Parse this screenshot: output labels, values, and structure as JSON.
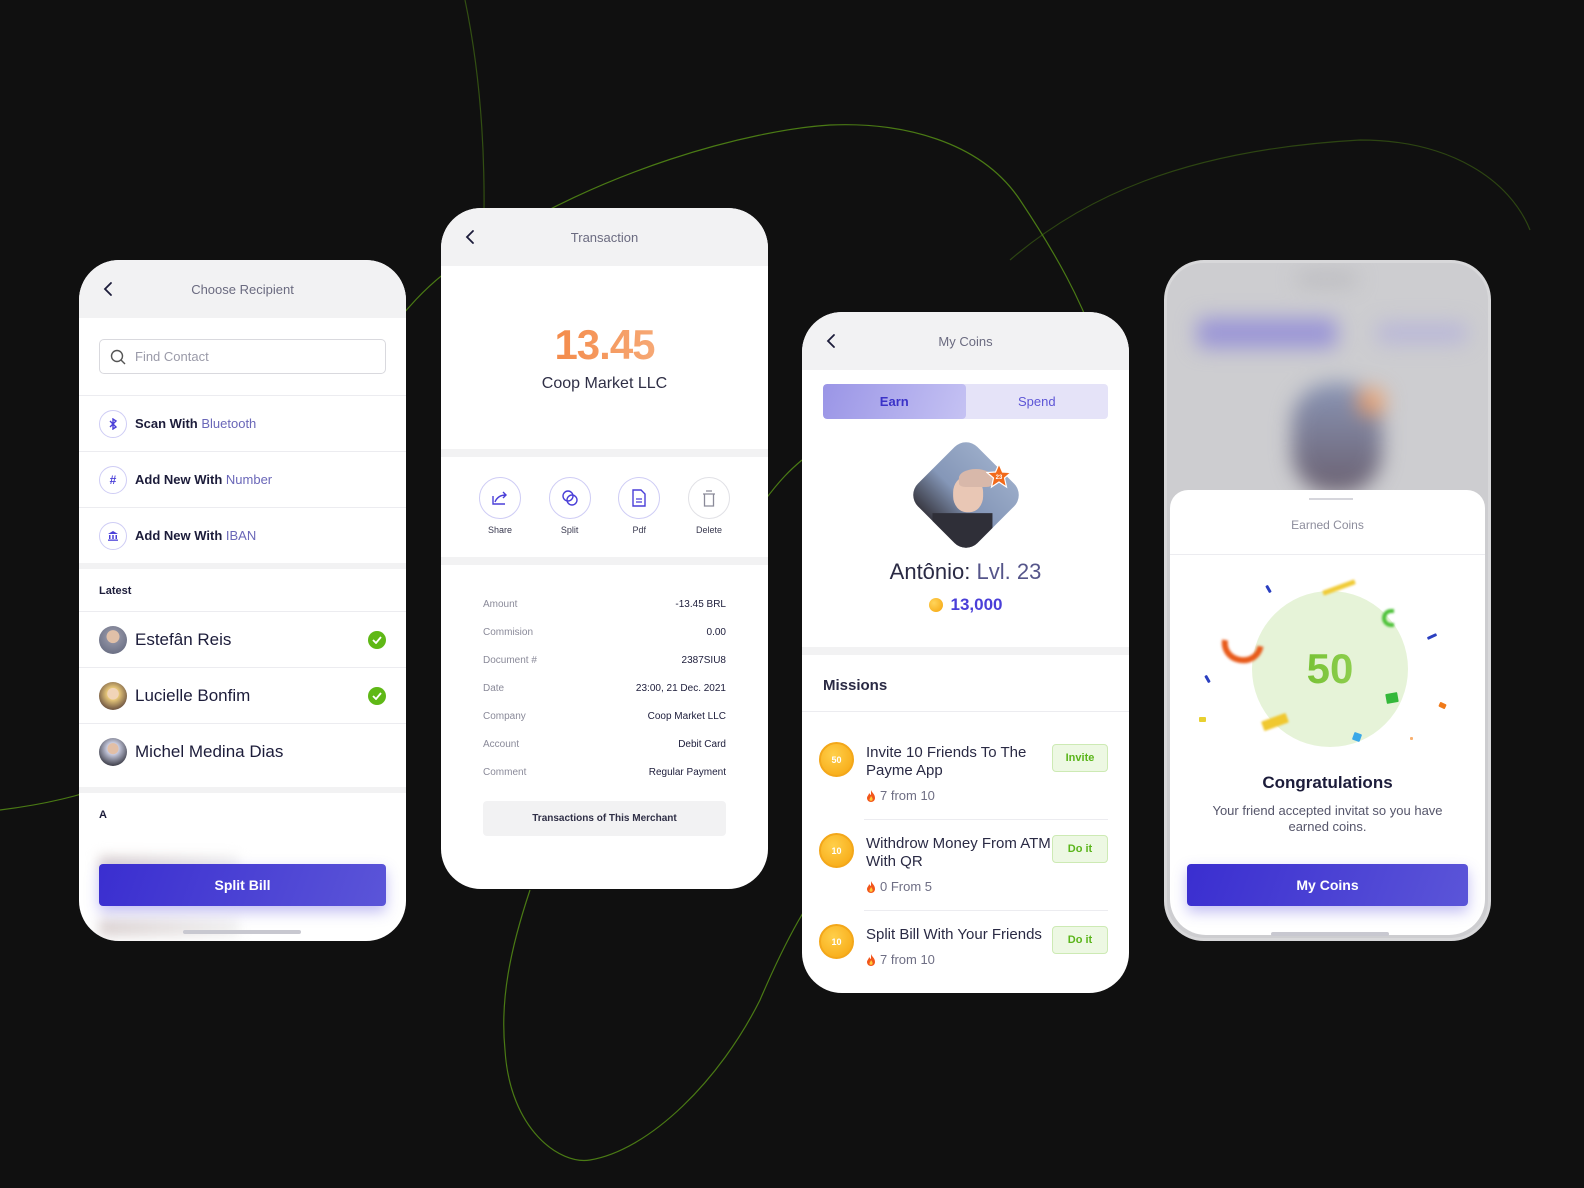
{
  "colors": {
    "background": "#101010",
    "accent": "#4a3fd8",
    "amount_orange": "#f26a1b",
    "success_green": "#5fb816",
    "coin_gold": "#f6a50e",
    "decor_line": "#4a7a14"
  },
  "choose_recipient": {
    "title": "Choose Recipient",
    "back_icon": "chevron-left-icon",
    "search": {
      "placeholder": "Find Contact",
      "value": "",
      "icon": "search-icon"
    },
    "actions": [
      {
        "icon": "bluetooth-icon",
        "label_strong": "Scan With",
        "label_highlight": "Bluetooth"
      },
      {
        "icon": "hash-icon",
        "label_strong": "Add New With",
        "label_highlight": "Number"
      },
      {
        "icon": "bank-icon",
        "label_strong": "Add New With",
        "label_highlight": "IBAN"
      }
    ],
    "latest_label": "Latest",
    "contacts": [
      {
        "name": "Estefân Reis",
        "selected": true
      },
      {
        "name": "Lucielle Bonfim",
        "selected": true
      },
      {
        "name": "Michel Medina Dias",
        "selected": false
      }
    ],
    "alpha_label": "A",
    "primary_button": "Split Bill"
  },
  "transaction": {
    "title": "Transaction",
    "amount": "13.45",
    "merchant": "Coop Market LLC",
    "actions": [
      {
        "icon": "share-icon",
        "label": "Share"
      },
      {
        "icon": "split-icon",
        "label": "Split"
      },
      {
        "icon": "pdf-icon",
        "label": "Pdf"
      },
      {
        "icon": "trash-icon",
        "label": "Delete"
      }
    ],
    "details": [
      {
        "key": "Amount",
        "value": "-13.45 BRL"
      },
      {
        "key": "Commision",
        "value": "0.00"
      },
      {
        "key": "Document #",
        "value": "2387SIU8"
      },
      {
        "key": "Date",
        "value": "23:00, 21 Dec. 2021"
      },
      {
        "key": "Company",
        "value": "Coop Market LLC"
      },
      {
        "key": "Account",
        "value": "Debit Card"
      },
      {
        "key": "Comment",
        "value": "Regular Payment"
      }
    ],
    "merchant_button": "Transactions of This Merchant"
  },
  "my_coins": {
    "title": "My Coins",
    "tabs": [
      {
        "label": "Earn",
        "active": true
      },
      {
        "label": "Spend",
        "active": false
      }
    ],
    "profile": {
      "name": "Antônio:",
      "level": "Lvl. 23",
      "badge": "23",
      "coins": "13,000"
    },
    "missions_title": "Missions",
    "missions": [
      {
        "reward": "50",
        "title": "Invite 10 Friends To The Payme App",
        "progress": "7 from 10",
        "button": "Invite"
      },
      {
        "reward": "10",
        "title": "Withdrow Money From ATM With QR",
        "progress": "0 From 5",
        "button": "Do it"
      },
      {
        "reward": "10",
        "title": "Split Bill With Your Friends",
        "progress": "7 from 10",
        "button": "Do it"
      }
    ]
  },
  "earned_coins": {
    "sheet_title": "Earned Coins",
    "amount": "50",
    "heading": "Congratulations",
    "message": "Your friend accepted invitat so you have earned coins.",
    "primary_button": "My Coins"
  }
}
